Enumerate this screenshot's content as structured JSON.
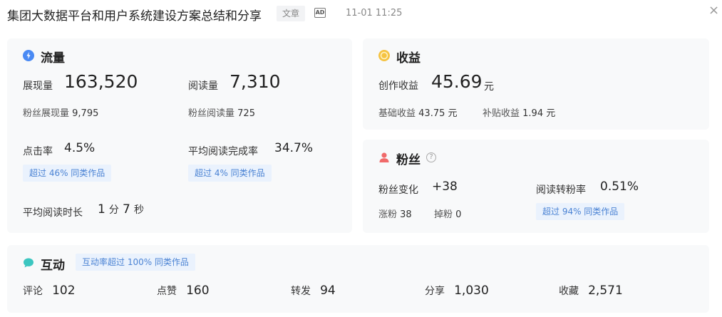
{
  "header": {
    "title": "集团大数据平台和用户系统建设方案总结和分享",
    "tag": "文章",
    "ad_icon": "AD",
    "time": "11-01 11:25",
    "close_icon": "×"
  },
  "flow": {
    "title": "流量",
    "impressions_label": "展现量",
    "impressions_value": "163,520",
    "reads_label": "阅读量",
    "reads_value": "7,310",
    "fan_impressions_label": "粉丝展现量",
    "fan_impressions_value": "9,795",
    "fan_reads_label": "粉丝阅读量",
    "fan_reads_value": "725",
    "ctr_label": "点击率",
    "ctr_value": "4.5%",
    "ctr_badge": "超过 46% 同类作品",
    "completion_label": "平均阅读完成率",
    "completion_value": "34.7%",
    "completion_badge": "超过 4% 同类作品",
    "duration_label": "平均阅读时长",
    "duration_min": "1",
    "duration_min_unit": "分",
    "duration_sec": "7",
    "duration_sec_unit": "秒"
  },
  "earnings": {
    "title": "收益",
    "creation_label": "创作收益",
    "creation_value": "45.69",
    "creation_unit": "元",
    "base_label": "基础收益",
    "base_value": "43.75 元",
    "subsidy_label": "补贴收益",
    "subsidy_value": "1.94 元"
  },
  "fans": {
    "title": "粉丝",
    "help_icon": "?",
    "change_label": "粉丝变化",
    "change_value": "+38",
    "conv_label": "阅读转粉率",
    "conv_value": "0.51%",
    "gain_label": "涨粉",
    "gain_value": "38",
    "loss_label": "掉粉",
    "loss_value": "0",
    "conv_badge": "超过 94% 同类作品"
  },
  "interaction": {
    "title": "互动",
    "badge": "互动率超过 100% 同类作品",
    "items": [
      {
        "label": "评论",
        "value": "102"
      },
      {
        "label": "点赞",
        "value": "160"
      },
      {
        "label": "转发",
        "value": "94"
      },
      {
        "label": "分享",
        "value": "1,030"
      },
      {
        "label": "收藏",
        "value": "2,571"
      }
    ]
  },
  "colors": {
    "accent_blue": "#4b83d4",
    "badge_bg": "#eaf2fd",
    "flow_icon": "#4a8af4",
    "earn_icon": "#f5c342",
    "fans_icon": "#f06a6a",
    "inter_icon": "#3cc6c0"
  }
}
